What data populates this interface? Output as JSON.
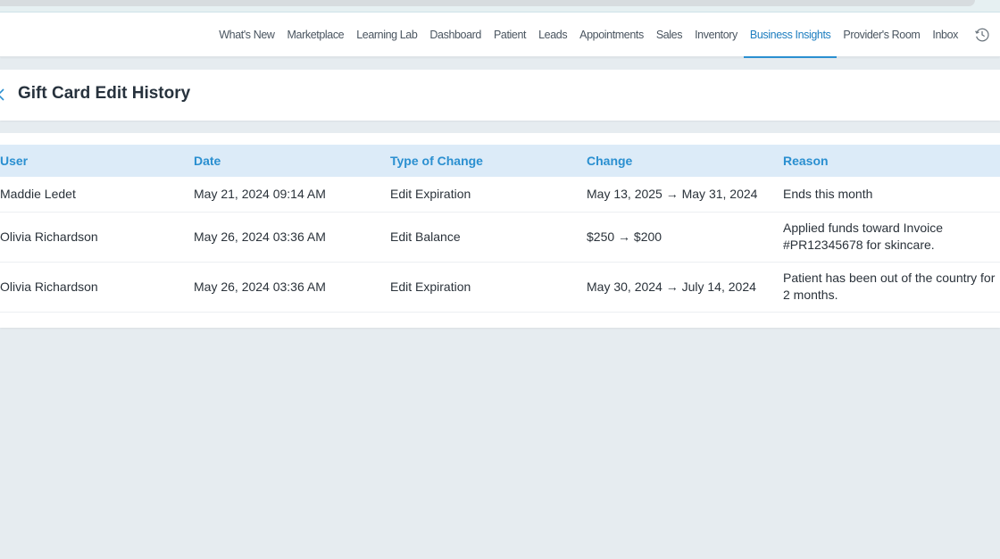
{
  "nav": {
    "items": [
      {
        "label": "What's New",
        "active": false
      },
      {
        "label": "Marketplace",
        "active": false
      },
      {
        "label": "Learning Lab",
        "active": false
      },
      {
        "label": "Dashboard",
        "active": false
      },
      {
        "label": "Patient",
        "active": false
      },
      {
        "label": "Leads",
        "active": false
      },
      {
        "label": "Appointments",
        "active": false
      },
      {
        "label": "Sales",
        "active": false
      },
      {
        "label": "Inventory",
        "active": false
      },
      {
        "label": "Business Insights",
        "active": true
      },
      {
        "label": "Provider's Room",
        "active": false
      },
      {
        "label": "Inbox",
        "active": false
      }
    ],
    "history_icon": "clock-history-icon"
  },
  "page": {
    "title": "Gift Card Edit History",
    "back_icon": "chevron-left-icon"
  },
  "table": {
    "headers": [
      "User",
      "Date",
      "Type of Change",
      "Change",
      "Reason"
    ],
    "rows": [
      [
        "Maddie Ledet",
        "May 21, 2024 09:14 AM",
        "Edit Expiration",
        "May 13, 2025 → May 31, 2024",
        "Ends this month"
      ],
      [
        "Olivia Richardson",
        "May 26, 2024 03:36 AM",
        "Edit Balance",
        "$250 → $200",
        "Applied funds toward Invoice #PR12345678 for skincare."
      ],
      [
        "Olivia Richardson",
        "May 26, 2024 03:36 AM",
        "Edit Expiration",
        "May 30, 2024 → July 14, 2024",
        "Patient has been out of the country for 2 months."
      ]
    ]
  },
  "colors": {
    "accent": "#2a8fd0",
    "header_bg": "#dcebf8",
    "page_bg": "#e6ecf0"
  }
}
